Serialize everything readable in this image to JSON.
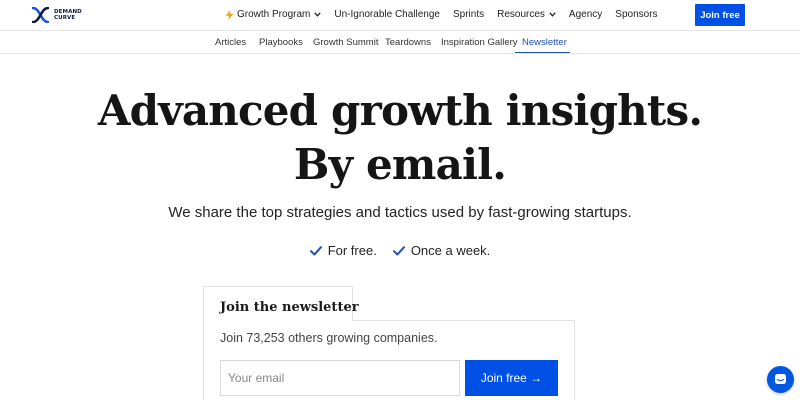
{
  "brand": {
    "line1": "DEMAND",
    "line2": "CURVE",
    "logo_icon": "demand-curve-logo"
  },
  "main_nav": [
    {
      "label": "Growth Program",
      "icon": "lightning-bolt",
      "dropdown": true
    },
    {
      "label": "Un-Ignorable Challenge"
    },
    {
      "label": "Sprints"
    },
    {
      "label": "Resources",
      "dropdown": true
    },
    {
      "label": "Agency"
    },
    {
      "label": "Sponsors"
    }
  ],
  "header": {
    "cta_label": "Join free"
  },
  "sub_nav": [
    {
      "label": "Articles"
    },
    {
      "label": "Playbooks"
    },
    {
      "label": "Growth Summit"
    },
    {
      "label": "Teardowns"
    },
    {
      "label": "Inspiration Gallery"
    },
    {
      "label": "Newsletter",
      "active": true
    }
  ],
  "hero": {
    "title_line1": "Advanced growth insights.",
    "title_line2": "By email.",
    "subtitle": "We share the top strategies and tactics used by fast-growing startups.",
    "benefits": [
      "For free.",
      "Once a week."
    ]
  },
  "newsletter": {
    "tab_label": "Join the newsletter",
    "subtitle": "Join 73,253 others growing companies.",
    "email_placeholder": "Your email",
    "email_value": "",
    "button_label": "Join free →"
  },
  "colors": {
    "primary": "#0050e6",
    "link_active": "#1f4fb5",
    "gold": "#e8a317"
  },
  "chat": {
    "icon": "chat-icon"
  }
}
